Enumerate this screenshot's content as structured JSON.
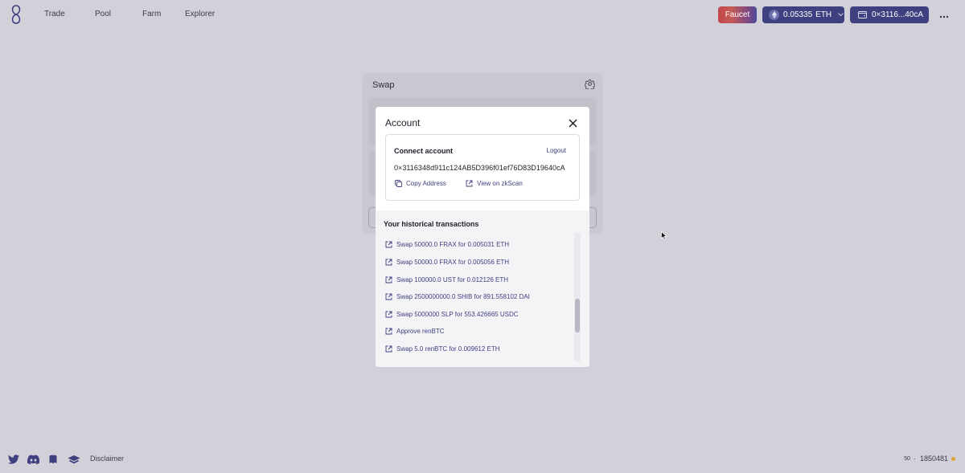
{
  "nav": {
    "items": [
      {
        "label": "Trade"
      },
      {
        "label": "Pool"
      },
      {
        "label": "Farm"
      },
      {
        "label": "Explorer"
      }
    ],
    "faucet_label": "Faucet",
    "eth_balance": "0.05335",
    "eth_unit": "ETH",
    "wallet_short": "0×3116...40cA"
  },
  "swap": {
    "title": "Swap"
  },
  "modal": {
    "title": "Account",
    "connect_label": "Connect account",
    "logout_label": "Logout",
    "address": "0×3116348d911c124AB5D396f01ef76D83D19640cA",
    "copy_label": "Copy Address",
    "zkscan_label": "View on zkScan",
    "history_title": "Your historical transactions",
    "transactions": [
      {
        "label": "Swap 50000.0 FRAX for 0.005031 ETH"
      },
      {
        "label": "Swap 50000.0 FRAX for 0.005056 ETH"
      },
      {
        "label": "Swap 100000.0 UST for 0.012126 ETH"
      },
      {
        "label": "Swap 2500000000.0 SHIB for 891.558102 DAI"
      },
      {
        "label": "Swap 5000000 SLP for 553.426665 USDC"
      },
      {
        "label": "Approve renBTC"
      },
      {
        "label": "Swap 5.0 renBTC for 0.009612 ETH"
      }
    ]
  },
  "footer": {
    "disclaimer": "Disclaimer",
    "left_num": "50",
    "separator": "·",
    "block_number": "1850481"
  },
  "colors": {
    "accent": "#3f4080",
    "status": "#e3a53a",
    "background": "#d2d1da"
  }
}
